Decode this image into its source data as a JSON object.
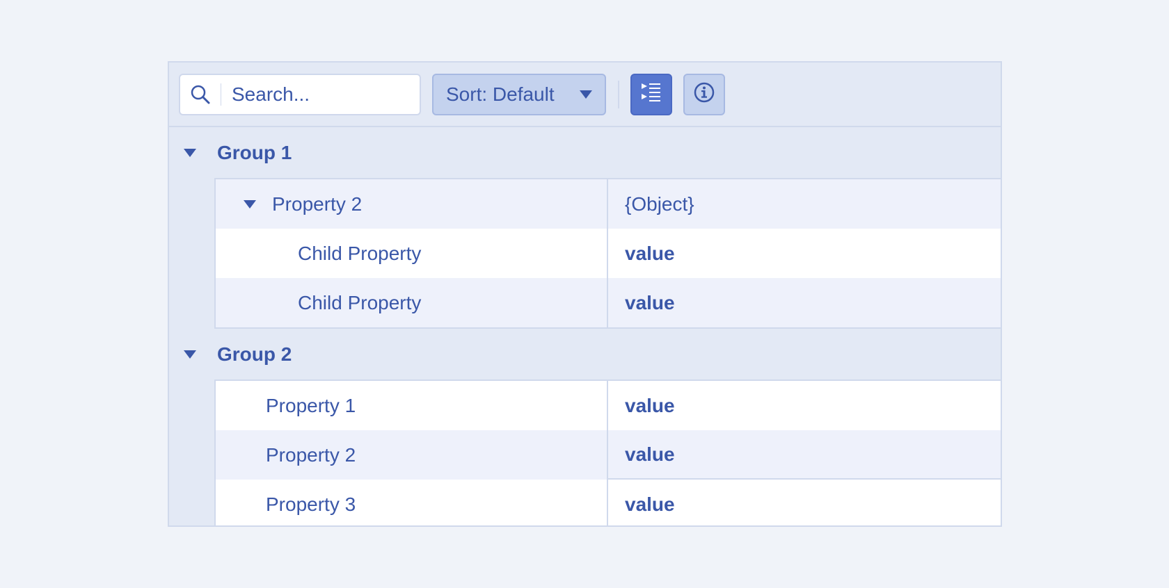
{
  "toolbar": {
    "search_placeholder": "Search...",
    "sort_label": "Sort: Default",
    "icons": {
      "search": "search-icon",
      "sort_dropdown": "chevron-down-icon",
      "categorized_view": "categorized-list-icon",
      "info": "info-icon"
    }
  },
  "groups": [
    {
      "label": "Group 1",
      "rows": [
        {
          "name": "Property 2",
          "value": "{Object}"
        },
        {
          "name": "Child Property",
          "value": "value"
        },
        {
          "name": "Child Property",
          "value": "value"
        }
      ]
    },
    {
      "label": "Group 2",
      "rows": [
        {
          "name": "Property 1",
          "value": "value"
        },
        {
          "name": "Property 2",
          "value": "value"
        },
        {
          "name": "Property 3",
          "value": "value"
        }
      ]
    }
  ],
  "colors": {
    "background": "#f0f3f9",
    "panel": "#e3e9f5",
    "border": "#d0d9ec",
    "text": "#3a57a8",
    "accent_button": "#5676cf",
    "alt_row": "#eef1fb"
  }
}
